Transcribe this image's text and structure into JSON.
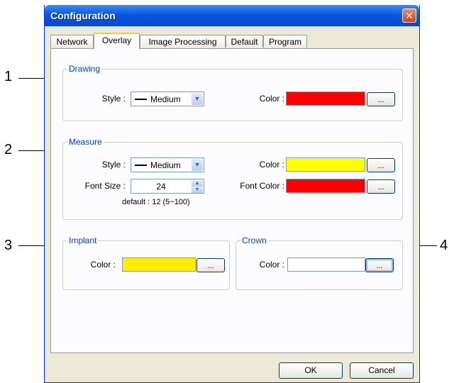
{
  "window": {
    "title": "Configuration",
    "close_glyph": "✕"
  },
  "tabs": [
    {
      "label": "Network",
      "active": false
    },
    {
      "label": "Overlay",
      "active": true
    },
    {
      "label": "Image Processing",
      "active": false
    },
    {
      "label": "Default",
      "active": false
    },
    {
      "label": "Program",
      "active": false
    }
  ],
  "drawing": {
    "title": "Drawing",
    "style_label": "Style :",
    "style_value": "Medium",
    "color_label": "Color :",
    "color": "#ff0000",
    "pick_label": "..."
  },
  "measure": {
    "title": "Measure",
    "style_label": "Style :",
    "style_value": "Medium",
    "color_label": "Color :",
    "color": "#ffff00",
    "pick_label": "...",
    "font_size_label": "Font Size :",
    "font_size_value": "24",
    "font_size_hint": "default : 12 (5~100)",
    "font_color_label": "Font Color :",
    "font_color": "#ff0000",
    "font_pick_label": "..."
  },
  "implant": {
    "title": "Implant",
    "color_label": "Color :",
    "color": "#ffee00",
    "pick_label": "..."
  },
  "crown": {
    "title": "Crown",
    "color_label": "Color :",
    "color": "#ffffff",
    "pick_label": "..."
  },
  "buttons": {
    "ok": "OK",
    "cancel": "Cancel"
  },
  "callouts": [
    "1",
    "2",
    "3",
    "4"
  ]
}
